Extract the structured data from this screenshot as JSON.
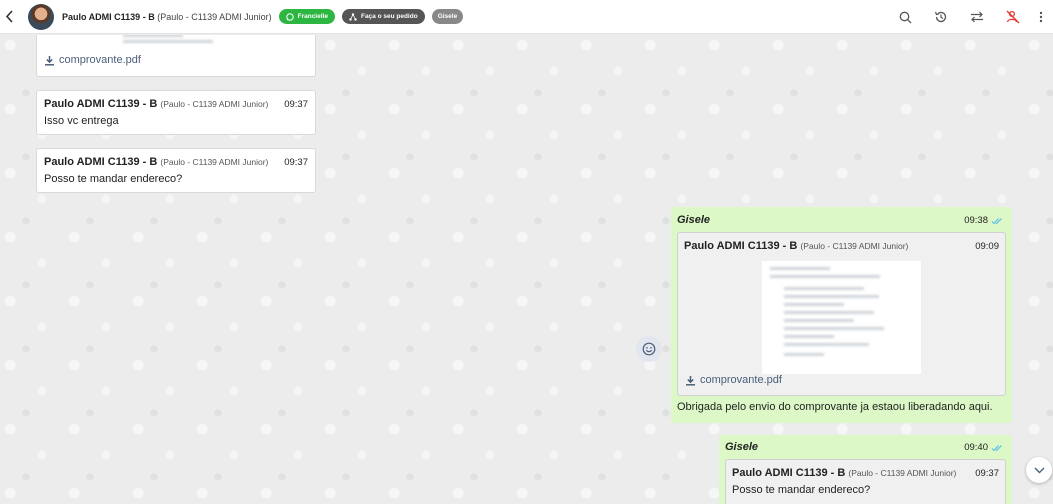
{
  "header": {
    "contact_name": "Paulo ADMI C1139 - B",
    "contact_sub": "(Paulo - C1139 ADMI Junior)",
    "badges": [
      "Francielle",
      "Faça o seu pedido",
      "Gisele"
    ]
  },
  "colors": {
    "incoming": "#ffffff",
    "outgoing": "#dcf8c6",
    "whatsapp_green": "#2db742",
    "transfer_icon_red": "#e53935"
  },
  "messages": [
    {
      "file": "comprovante.pdf"
    },
    {
      "sender": "Paulo ADMI C1139 - B",
      "sub": "(Paulo - C1139 ADMI Junior)",
      "time": "09:37",
      "text": "Isso vc entrega"
    },
    {
      "sender": "Paulo ADMI C1139 - B",
      "sub": "(Paulo - C1139 ADMI Junior)",
      "time": "09:37",
      "text": "Posso te mandar endereco?"
    },
    {
      "author": "Gisele",
      "time": "09:38",
      "quote": {
        "sender": "Paulo ADMI C1139 - B",
        "sub": "(Paulo - C1139 ADMI Junior)",
        "time": "09:09",
        "file": "comprovante.pdf"
      },
      "text": "Obrigada pelo envio do comprovante ja estaou liberadando aqui."
    },
    {
      "author": "Gisele",
      "time": "09:40",
      "quote": {
        "sender": "Paulo ADMI C1139 - B",
        "sub": "(Paulo - C1139 ADMI Junior)",
        "time": "09:37",
        "text": "Posso te mandar endereco?"
      }
    }
  ]
}
